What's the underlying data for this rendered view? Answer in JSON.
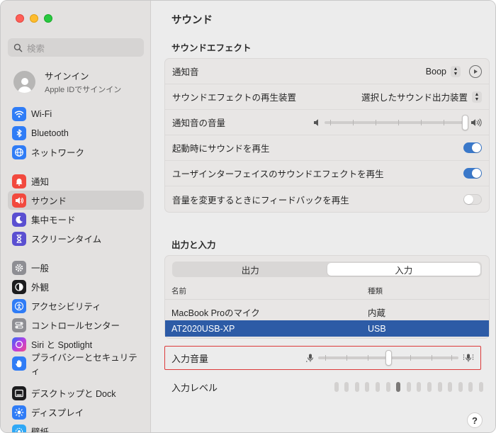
{
  "window": {
    "title": "サウンド"
  },
  "sidebar": {
    "search_placeholder": "検索",
    "account": {
      "name": "サインイン",
      "sub": "Apple IDでサインイン"
    },
    "items": [
      {
        "label": "Wi-Fi",
        "icon": "wifi-icon",
        "color": "#2f7cf6"
      },
      {
        "label": "Bluetooth",
        "icon": "bluetooth-icon",
        "color": "#2f7cf6"
      },
      {
        "label": "ネットワーク",
        "icon": "globe-icon",
        "color": "#2f7cf6"
      },
      {
        "label": "通知",
        "icon": "bell-icon",
        "color": "#f2493e"
      },
      {
        "label": "サウンド",
        "icon": "speaker-icon",
        "color": "#f2493e",
        "active": true
      },
      {
        "label": "集中モード",
        "icon": "moon-icon",
        "color": "#5a4fd1"
      },
      {
        "label": "スクリーンタイム",
        "icon": "hourglass-icon",
        "color": "#5a4fd1"
      },
      {
        "label": "一般",
        "icon": "gear-icon",
        "color": "#8e8e93"
      },
      {
        "label": "外観",
        "icon": "appearance-icon",
        "color": "#1c1c1e"
      },
      {
        "label": "アクセシビリティ",
        "icon": "accessibility-icon",
        "color": "#2f7cf6"
      },
      {
        "label": "コントロールセンター",
        "icon": "control-center-icon",
        "color": "#8e8e93"
      },
      {
        "label": "Siri と Spotlight",
        "icon": "siri-icon",
        "color": "#7b3fe4"
      },
      {
        "label": "プライバシーとセキュリティ",
        "icon": "hand-icon",
        "color": "#2f7cf6"
      },
      {
        "label": "デスクトップと Dock",
        "icon": "dock-icon",
        "color": "#1c1c1e"
      },
      {
        "label": "ディスプレイ",
        "icon": "sun-icon",
        "color": "#2f7cf6"
      },
      {
        "label": "壁紙",
        "icon": "wallpaper-icon",
        "color": "#2fa8f6"
      }
    ]
  },
  "main": {
    "title": "サウンド",
    "effects_title": "サウンドエフェクト",
    "alert_sound": {
      "label": "通知音",
      "value": "Boop"
    },
    "effects_device": {
      "label": "サウンドエフェクトの再生装置",
      "value": "選択したサウンド出力装置"
    },
    "alert_volume": {
      "label": "通知音の音量",
      "level": 1.0
    },
    "startup_sound": {
      "label": "起動時にサウンドを再生",
      "on": true
    },
    "ui_effects": {
      "label": "ユーザインターフェイスのサウンドエフェクトを再生",
      "on": true
    },
    "volume_feedback": {
      "label": "音量を変更するときにフィードバックを再生",
      "on": false
    },
    "io_title": "出力と入力",
    "tabs": [
      {
        "label": "出力",
        "active": false
      },
      {
        "label": "入力",
        "active": true
      }
    ],
    "device_headers": {
      "name": "名前",
      "type": "種類"
    },
    "devices": [
      {
        "name": "MacBook Proのマイク",
        "type": "内蔵",
        "selected": false
      },
      {
        "name": "AT2020USB-XP",
        "type": "USB",
        "selected": true
      }
    ],
    "input_volume": {
      "label": "入力音量",
      "level": 0.5
    },
    "input_level": {
      "label": "入力レベル",
      "bars": 15,
      "active_bar": 6
    },
    "help": "?"
  },
  "colors": {
    "accent": "#3a78c9",
    "selection": "#2d5ba6",
    "highlight_border": "#dc3a3a"
  }
}
